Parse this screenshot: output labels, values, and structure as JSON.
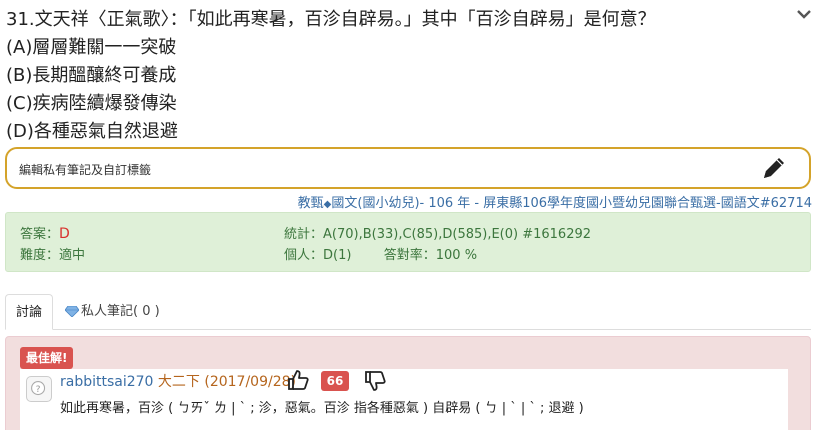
{
  "question": {
    "stem": "31.文天祥〈正氣歌〉：「如此再寒暑，百沴自辟易。」其中「百沴自辟易」是何意？",
    "options": [
      "(A)層層難關一一突破",
      "(B)長期醞釀終可養成",
      "(C)疾病陸續爆發傳染",
      "(D)各種惡氣自然退避"
    ]
  },
  "note": {
    "label": "編輯私有筆記及自訂標籤"
  },
  "source": {
    "prefix": "教甄",
    "rest": "國文(國小幼兒)- 106 年 - 屏東縣106學年度國小暨幼兒園聯合甄選-國語文#62714"
  },
  "answer": {
    "answer_label": "答案：",
    "answer_value": "D",
    "difficulty_label": "難度：",
    "difficulty_value": "適中",
    "stats_label": "統計：",
    "stats_value": "A(70),B(33),C(85),D(585),E(0) #1616292",
    "personal_label": "個人：",
    "personal_value": "D(1)",
    "accuracy_label": "答對率：",
    "accuracy_value": "100 %"
  },
  "tabs": [
    {
      "label": "討論"
    },
    {
      "label": "私人筆記( 0 )"
    }
  ],
  "best": {
    "badge": "最佳解!",
    "user": "rabbittsai270",
    "grade": "大二下 (2017/09/28)",
    "likes": "66",
    "text": "如此再寒暑，百沴 ( ㄅㄞˇ  ㄌ | ˋ ; 沴，惡氣。百沴 指各種惡氣 ) 自辟易 ( ㄅ |  ˋ   | ˋ ; 退避 )"
  },
  "colors": {
    "highlight_border": "#d4a32a",
    "answer_bg": "#dff0d8",
    "answer_text": "#3c763d",
    "accent_red": "#d9534f",
    "best_bg": "#f2dede",
    "link_blue": "#3a6ea5"
  }
}
